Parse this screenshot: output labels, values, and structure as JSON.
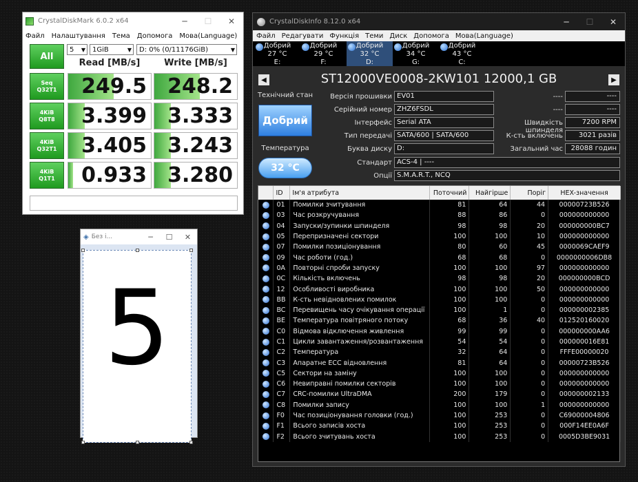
{
  "cdm": {
    "title": "CrystalDiskMark 6.0.2 x64",
    "menu": [
      "Файл",
      "Налаштування",
      "Тема",
      "Допомога",
      "Мова(Language)"
    ],
    "all_label": "All",
    "count": "5",
    "size": "1GiB",
    "drive": "D: 0% (0/11176GiB)",
    "read_header": "Read [MB/s]",
    "write_header": "Write [MB/s]",
    "rows": [
      {
        "label1": "Seq",
        "label2": "Q32T1",
        "read": "249.5",
        "write": "248.2",
        "read_frac": 0.55,
        "write_frac": 0.55
      },
      {
        "label1": "4KiB",
        "label2": "Q8T8",
        "read": "3.399",
        "write": "3.333",
        "read_frac": 0.2,
        "write_frac": 0.2
      },
      {
        "label1": "4KiB",
        "label2": "Q32T1",
        "read": "3.405",
        "write": "3.243",
        "read_frac": 0.2,
        "write_frac": 0.2
      },
      {
        "label1": "4KiB",
        "label2": "Q1T1",
        "read": "0.933",
        "write": "3.280",
        "read_frac": 0.06,
        "write_frac": 0.2
      }
    ]
  },
  "paint": {
    "title": "Без і...",
    "digit": "5"
  },
  "cdi": {
    "title": "CrystalDiskInfo 8.12.0 x64",
    "menu": [
      "Файл",
      "Редагувати",
      "Функція",
      "Теми",
      "Диск",
      "Допомога",
      "Мова(Language)"
    ],
    "drives": [
      {
        "status": "Добрий",
        "temp": "27 °C",
        "letter": "E:"
      },
      {
        "status": "Добрий",
        "temp": "29 °C",
        "letter": "F:"
      },
      {
        "status": "Добрий",
        "temp": "32 °C",
        "letter": "D:"
      },
      {
        "status": "Добрий",
        "temp": "34 °C",
        "letter": "G:"
      },
      {
        "status": "Добрий",
        "temp": "43 °C",
        "letter": "C:"
      }
    ],
    "model": "ST12000VE0008-2KW101 12000,1 GB",
    "health_label": "Технічний стан",
    "health_value": "Добрий",
    "temp_label": "Температура",
    "temp_value": "32 °C",
    "firmware_label": "Версія прошивки",
    "firmware": "EV01",
    "serial_label": "Серійний номер",
    "serial": "ZHZ6FSDL",
    "interface_label": "Інтерфейс",
    "interface": "Serial ATA",
    "transfer_label": "Тип передачі",
    "transfer": "SATA/600 | SATA/600",
    "letter_label": "Буква диску",
    "letter": "D:",
    "standard_label": "Стандарт",
    "standard": "ACS-4 | ----",
    "features_label": "Опції",
    "features": "S.M.A.R.T., NCQ",
    "blank1_label": "----",
    "blank1": "----",
    "blank2_label": "----",
    "blank2": "----",
    "rpm_label": "Швидкість шпинделя",
    "rpm": "7200 RPM",
    "power_count_label": "К-сть включень",
    "power_count": "3021 разів",
    "power_hours_label": "Загальний час",
    "power_hours": "28088 годин",
    "smart_headers": [
      "ID",
      "Ім'я атрибута",
      "Поточний",
      "Найгірше",
      "Поріг",
      "HEX-значення"
    ],
    "smart": [
      {
        "id": "01",
        "name": "Помилки зчитування",
        "cur": "81",
        "worst": "64",
        "thr": "44",
        "raw": "00000723B526"
      },
      {
        "id": "03",
        "name": "Час розкручування",
        "cur": "88",
        "worst": "86",
        "thr": "0",
        "raw": "000000000000"
      },
      {
        "id": "04",
        "name": "Запуски/зупинки шпинделя",
        "cur": "98",
        "worst": "98",
        "thr": "20",
        "raw": "000000000BC7"
      },
      {
        "id": "05",
        "name": "Перепризначені сектори",
        "cur": "100",
        "worst": "100",
        "thr": "10",
        "raw": "000000000000"
      },
      {
        "id": "07",
        "name": "Помилки позиціонування",
        "cur": "80",
        "worst": "60",
        "thr": "45",
        "raw": "0000069CAEF9"
      },
      {
        "id": "09",
        "name": "Час роботи (год.)",
        "cur": "68",
        "worst": "68",
        "thr": "0",
        "raw": "0000000006DB8"
      },
      {
        "id": "0A",
        "name": "Повторні спроби запуску",
        "cur": "100",
        "worst": "100",
        "thr": "97",
        "raw": "000000000000"
      },
      {
        "id": "0C",
        "name": "Кількість включень",
        "cur": "98",
        "worst": "98",
        "thr": "20",
        "raw": "000000000BCD"
      },
      {
        "id": "12",
        "name": "Особливості виробника",
        "cur": "100",
        "worst": "100",
        "thr": "50",
        "raw": "000000000000"
      },
      {
        "id": "BB",
        "name": "К-сть невідновлених помилок",
        "cur": "100",
        "worst": "100",
        "thr": "0",
        "raw": "000000000000"
      },
      {
        "id": "BC",
        "name": "Перевищень часу очікування операції",
        "cur": "100",
        "worst": "1",
        "thr": "0",
        "raw": "000000002385"
      },
      {
        "id": "BE",
        "name": "Температура повітряного потоку",
        "cur": "68",
        "worst": "36",
        "thr": "40",
        "raw": "012520160020"
      },
      {
        "id": "C0",
        "name": "Відмова відключення живлення",
        "cur": "99",
        "worst": "99",
        "thr": "0",
        "raw": "000000000AA6"
      },
      {
        "id": "C1",
        "name": "Цикли завантаження/розвантаження",
        "cur": "54",
        "worst": "54",
        "thr": "0",
        "raw": "000000016E81"
      },
      {
        "id": "C2",
        "name": "Температура",
        "cur": "32",
        "worst": "64",
        "thr": "0",
        "raw": "FFFE00000020"
      },
      {
        "id": "C3",
        "name": "Апаратне ECC відновлення",
        "cur": "81",
        "worst": "64",
        "thr": "0",
        "raw": "00000723B526"
      },
      {
        "id": "C5",
        "name": "Сектори на заміну",
        "cur": "100",
        "worst": "100",
        "thr": "0",
        "raw": "000000000000"
      },
      {
        "id": "C6",
        "name": "Невиправні помилки секторів",
        "cur": "100",
        "worst": "100",
        "thr": "0",
        "raw": "000000000000"
      },
      {
        "id": "C7",
        "name": "CRC-помилки UltraDMA",
        "cur": "200",
        "worst": "179",
        "thr": "0",
        "raw": "000000002133"
      },
      {
        "id": "C8",
        "name": "Помилки запису",
        "cur": "100",
        "worst": "100",
        "thr": "1",
        "raw": "000000000000"
      },
      {
        "id": "F0",
        "name": "Час позиціонування головки (год.)",
        "cur": "100",
        "worst": "253",
        "thr": "0",
        "raw": "C69000004806"
      },
      {
        "id": "F1",
        "name": "Всього записів хоста",
        "cur": "100",
        "worst": "253",
        "thr": "0",
        "raw": "000F14EE0A6F"
      },
      {
        "id": "F2",
        "name": "Всього зчитувань хоста",
        "cur": "100",
        "worst": "253",
        "thr": "0",
        "raw": "0005D3BE9031"
      }
    ]
  }
}
